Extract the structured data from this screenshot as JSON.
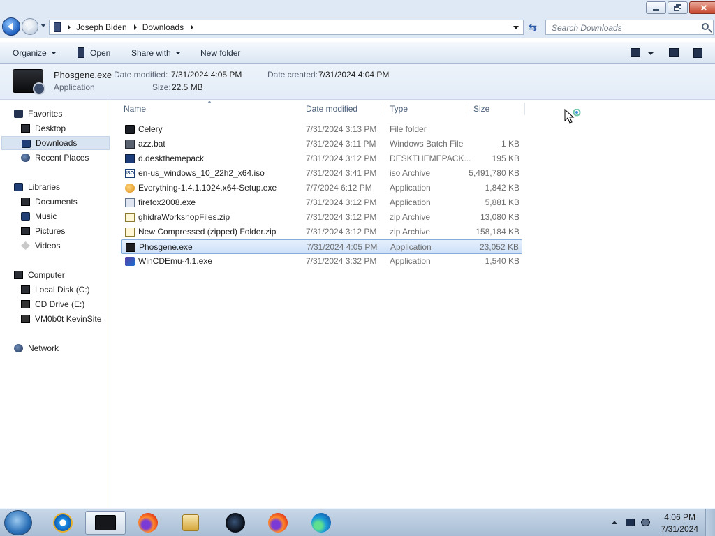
{
  "window": {
    "controls": {
      "minimize": "minimize",
      "maximize": "restore",
      "close": "close"
    }
  },
  "nav": {
    "breadcrumb": [
      "Joseph Biden",
      "Downloads"
    ],
    "search_placeholder": "Search Downloads"
  },
  "toolbar": {
    "organize": "Organize",
    "open": "Open",
    "share_with": "Share with",
    "new_folder": "New folder"
  },
  "details": {
    "name": "Phosgene.exe",
    "kind": "Application",
    "date_modified_label": "Date modified:",
    "date_modified": "7/31/2024 4:05 PM",
    "date_created_label": "Date created:",
    "date_created": "7/31/2024 4:04 PM",
    "size_label": "Size:",
    "size": "22.5 MB"
  },
  "sidebar": {
    "favorites": {
      "label": "Favorites",
      "items": [
        "Desktop",
        "Downloads",
        "Recent Places"
      ]
    },
    "libraries": {
      "label": "Libraries",
      "items": [
        "Documents",
        "Music",
        "Pictures",
        "Videos"
      ]
    },
    "computer": {
      "label": "Computer",
      "items": [
        "Local Disk (C:)",
        "CD Drive (E:)",
        "VM0b0t KevinSite"
      ]
    },
    "network": {
      "label": "Network"
    }
  },
  "columns": {
    "name": "Name",
    "date": "Date modified",
    "type": "Type",
    "size": "Size"
  },
  "files": [
    {
      "name": "Celery",
      "date": "7/31/2024 3:13 PM",
      "type": "File folder",
      "size": "",
      "icon": "folder-icon"
    },
    {
      "name": "azz.bat",
      "date": "7/31/2024 3:11 PM",
      "type": "Windows Batch File",
      "size": "1 KB",
      "icon": "batch-file-icon"
    },
    {
      "name": "d.deskthemepack",
      "date": "7/31/2024 3:12 PM",
      "type": "DESKTHEMEPACK...",
      "size": "195 KB",
      "icon": "themepack-icon"
    },
    {
      "name": "en-us_windows_10_22h2_x64.iso",
      "date": "7/31/2024 3:41 PM",
      "type": "iso Archive",
      "size": "5,491,780 KB",
      "icon": "iso-icon"
    },
    {
      "name": "Everything-1.4.1.1024.x64-Setup.exe",
      "date": "7/7/2024 6:12 PM",
      "type": "Application",
      "size": "1,842 KB",
      "icon": "magnifier-app-icon"
    },
    {
      "name": "firefox2008.exe",
      "date": "7/31/2024 3:12 PM",
      "type": "Application",
      "size": "5,881 KB",
      "icon": "exe-icon"
    },
    {
      "name": "ghidraWorkshopFiles.zip",
      "date": "7/31/2024 3:12 PM",
      "type": "zip Archive",
      "size": "13,080 KB",
      "icon": "zip-icon"
    },
    {
      "name": "New Compressed (zipped) Folder.zip",
      "date": "7/31/2024 3:12 PM",
      "type": "zip Archive",
      "size": "158,184 KB",
      "icon": "zip-icon"
    },
    {
      "name": "Phosgene.exe",
      "date": "7/31/2024 4:05 PM",
      "type": "Application",
      "size": "23,052 KB",
      "icon": "phosgene-exe-icon"
    },
    {
      "name": "WinCDEmu-4.1.exe",
      "date": "7/31/2024 3:32 PM",
      "type": "Application",
      "size": "1,540 KB",
      "icon": "wincdemu-icon"
    }
  ],
  "taskbar": {
    "apps": [
      "internet-explorer",
      "windows-explorer",
      "firefox",
      "media-player",
      "dark-app",
      "firefox",
      "edge"
    ],
    "clock_time": "4:06 PM",
    "clock_date": "7/31/2024"
  }
}
